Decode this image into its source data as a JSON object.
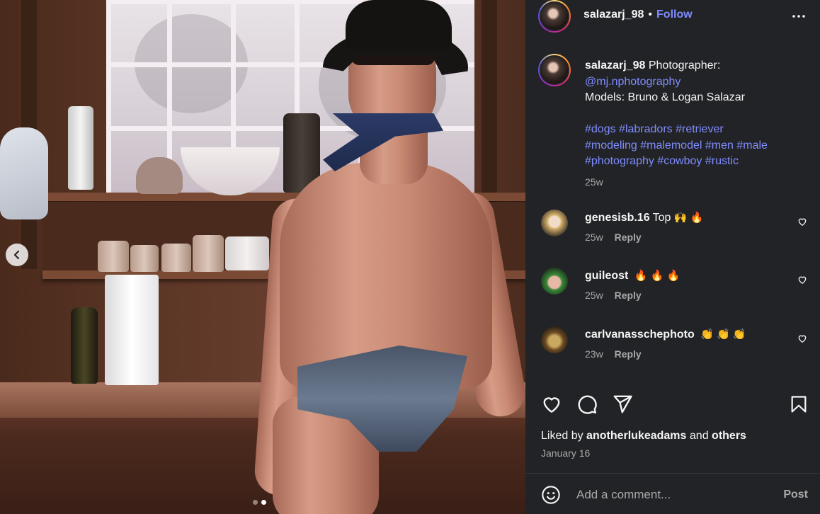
{
  "post": {
    "username": "salazarj_98",
    "separator": "•",
    "follow_label": "Follow",
    "caption": {
      "username": "salazarj_98",
      "text_1": "Photographer:",
      "mention": "@mj.nphotography",
      "models": "Models: Bruno & Logan Salazar",
      "hashtags_line1": "#dogs #labradors #retriever",
      "hashtags_line2": "#modeling #malemodel #men #male",
      "hashtags_line3": "#photography #cowboy #rustic",
      "age": "25w"
    },
    "comments": [
      {
        "username": "genesisb.16",
        "text": "Top",
        "emoji": "🙌 🔥",
        "age": "25w",
        "reply": "Reply"
      },
      {
        "username": "guileost",
        "text": "",
        "emoji": "🔥 🔥 🔥",
        "age": "25w",
        "reply": "Reply"
      },
      {
        "username": "carlvanasschephoto",
        "text": "",
        "emoji": "👏 👏 👏",
        "age": "23w",
        "reply": "Reply"
      }
    ],
    "liked_by_prefix": "Liked by",
    "liked_by_user": "anotherlukeadams",
    "liked_by_and": "and",
    "liked_by_others": "others",
    "date": "January 16",
    "comment_placeholder": "Add a comment...",
    "post_label": "Post"
  },
  "carousel": {
    "total": 2,
    "active": 2
  },
  "icons": {
    "prev": "chevron-left-icon",
    "more": "more-horizontal-icon",
    "like": "heart-icon",
    "comment": "comment-icon",
    "share": "send-icon",
    "save": "bookmark-icon",
    "emoji": "emoji-icon"
  },
  "colors": {
    "link": "#7f8cff",
    "panel_bg": "#222326",
    "muted": "#a8a8a8"
  }
}
